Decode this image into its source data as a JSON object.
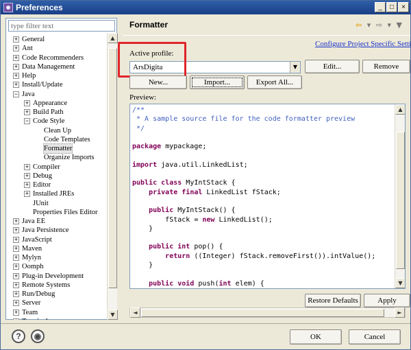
{
  "window": {
    "title": "Preferences",
    "controls": {
      "minimize": "_",
      "maximize": "□",
      "close": "×"
    }
  },
  "filter": {
    "placeholder": "type filter text"
  },
  "tree": [
    {
      "label": "General",
      "level": 0,
      "expander": "+"
    },
    {
      "label": "Ant",
      "level": 0,
      "expander": "+"
    },
    {
      "label": "Code Recommenders",
      "level": 0,
      "expander": "+"
    },
    {
      "label": "Data Management",
      "level": 0,
      "expander": "+"
    },
    {
      "label": "Help",
      "level": 0,
      "expander": "+"
    },
    {
      "label": "Install/Update",
      "level": 0,
      "expander": "+"
    },
    {
      "label": "Java",
      "level": 0,
      "expander": "−"
    },
    {
      "label": "Appearance",
      "level": 1,
      "expander": "+"
    },
    {
      "label": "Build Path",
      "level": 1,
      "expander": "+"
    },
    {
      "label": "Code Style",
      "level": 1,
      "expander": "−"
    },
    {
      "label": "Clean Up",
      "level": 2,
      "expander": ""
    },
    {
      "label": "Code Templates",
      "level": 2,
      "expander": ""
    },
    {
      "label": "Formatter",
      "level": 2,
      "expander": "",
      "selected": true
    },
    {
      "label": "Organize Imports",
      "level": 2,
      "expander": ""
    },
    {
      "label": "Compiler",
      "level": 1,
      "expander": "+"
    },
    {
      "label": "Debug",
      "level": 1,
      "expander": "+"
    },
    {
      "label": "Editor",
      "level": 1,
      "expander": "+"
    },
    {
      "label": "Installed JREs",
      "level": 1,
      "expander": "+"
    },
    {
      "label": "JUnit",
      "level": 1,
      "expander": ""
    },
    {
      "label": "Properties Files Editor",
      "level": 1,
      "expander": ""
    },
    {
      "label": "Java EE",
      "level": 0,
      "expander": "+"
    },
    {
      "label": "Java Persistence",
      "level": 0,
      "expander": "+"
    },
    {
      "label": "JavaScript",
      "level": 0,
      "expander": "+"
    },
    {
      "label": "Maven",
      "level": 0,
      "expander": "+"
    },
    {
      "label": "Mylyn",
      "level": 0,
      "expander": "+"
    },
    {
      "label": "Oomph",
      "level": 0,
      "expander": "+"
    },
    {
      "label": "Plug-in Development",
      "level": 0,
      "expander": "+"
    },
    {
      "label": "Remote Systems",
      "level": 0,
      "expander": "+"
    },
    {
      "label": "Run/Debug",
      "level": 0,
      "expander": "+"
    },
    {
      "label": "Server",
      "level": 0,
      "expander": "+"
    },
    {
      "label": "Team",
      "level": 0,
      "expander": "+"
    },
    {
      "label": "Terminal",
      "level": 0,
      "expander": "+"
    }
  ],
  "page": {
    "title": "Formatter",
    "nav": {
      "back": "⇦",
      "back_menu": "▾",
      "forward": "⇨",
      "forward_menu": "▾",
      "view_menu": "▼"
    },
    "config_link": "Configure Project Specific Settin"
  },
  "profile": {
    "label": "Active profile:",
    "value": "ArsDigita",
    "dropdown": "▼",
    "edit": "Edit...",
    "remove": "Remove",
    "new": "New...",
    "import": "Import...",
    "export": "Export All..."
  },
  "preview": {
    "label": "Preview:",
    "lines": [
      "/**",
      " * A sample source file for the code formatter preview",
      " */",
      "",
      "package mypackage;",
      "",
      "import java.util.LinkedList;",
      "",
      "public class MyIntStack {",
      "    private final LinkedList fStack;",
      "",
      "    public MyIntStack() {",
      "        fStack = new LinkedList();",
      "    }",
      "",
      "    public int pop() {",
      "        return ((Integer) fStack.removeFirst()).intValue();",
      "    }",
      "",
      "    public void push(int elem) {"
    ]
  },
  "scroll": {
    "up": "▲",
    "down": "▼",
    "left": "◄",
    "right": "►"
  },
  "actions": {
    "restore_defaults": "Restore Defaults",
    "apply": "Apply"
  },
  "footer": {
    "help": "?",
    "settings": "◉",
    "ok": "OK",
    "cancel": "Cancel"
  },
  "colors": {
    "title_bar": "#1a3f86",
    "highlight": "#e0252a",
    "link": "#1a31c9",
    "comment": "#3f5fbf",
    "keyword": "#7f0055"
  }
}
